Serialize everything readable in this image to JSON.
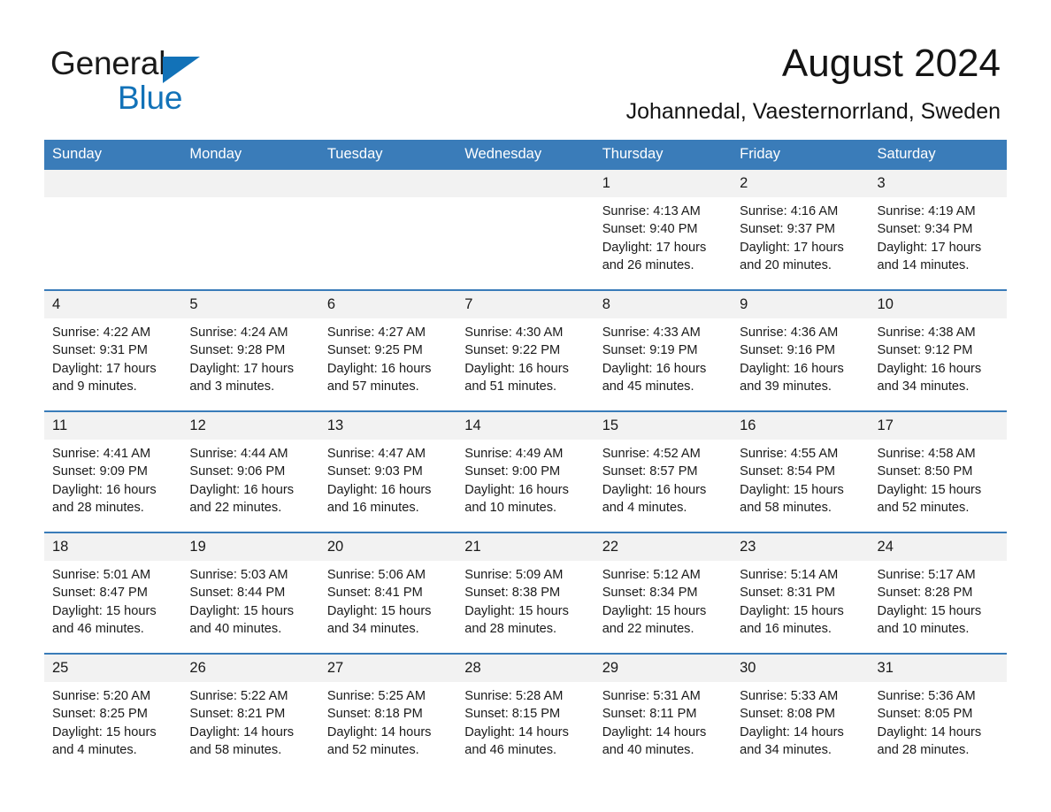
{
  "brand": {
    "name_part1": "General",
    "name_part2": "Blue",
    "triangle_color": "#1272b8",
    "accent_color": "#3a7cb9"
  },
  "header": {
    "month_title": "August 2024",
    "location": "Johannedal, Vaesternorrland, Sweden"
  },
  "calendar": {
    "weekday_headers": [
      "Sunday",
      "Monday",
      "Tuesday",
      "Wednesday",
      "Thursday",
      "Friday",
      "Saturday"
    ],
    "weeks": [
      [
        {
          "day": "",
          "sunrise": "",
          "sunset": "",
          "daylight_line1": "",
          "daylight_line2": ""
        },
        {
          "day": "",
          "sunrise": "",
          "sunset": "",
          "daylight_line1": "",
          "daylight_line2": ""
        },
        {
          "day": "",
          "sunrise": "",
          "sunset": "",
          "daylight_line1": "",
          "daylight_line2": ""
        },
        {
          "day": "",
          "sunrise": "",
          "sunset": "",
          "daylight_line1": "",
          "daylight_line2": ""
        },
        {
          "day": "1",
          "sunrise": "Sunrise: 4:13 AM",
          "sunset": "Sunset: 9:40 PM",
          "daylight_line1": "Daylight: 17 hours",
          "daylight_line2": "and 26 minutes."
        },
        {
          "day": "2",
          "sunrise": "Sunrise: 4:16 AM",
          "sunset": "Sunset: 9:37 PM",
          "daylight_line1": "Daylight: 17 hours",
          "daylight_line2": "and 20 minutes."
        },
        {
          "day": "3",
          "sunrise": "Sunrise: 4:19 AM",
          "sunset": "Sunset: 9:34 PM",
          "daylight_line1": "Daylight: 17 hours",
          "daylight_line2": "and 14 minutes."
        }
      ],
      [
        {
          "day": "4",
          "sunrise": "Sunrise: 4:22 AM",
          "sunset": "Sunset: 9:31 PM",
          "daylight_line1": "Daylight: 17 hours",
          "daylight_line2": "and 9 minutes."
        },
        {
          "day": "5",
          "sunrise": "Sunrise: 4:24 AM",
          "sunset": "Sunset: 9:28 PM",
          "daylight_line1": "Daylight: 17 hours",
          "daylight_line2": "and 3 minutes."
        },
        {
          "day": "6",
          "sunrise": "Sunrise: 4:27 AM",
          "sunset": "Sunset: 9:25 PM",
          "daylight_line1": "Daylight: 16 hours",
          "daylight_line2": "and 57 minutes."
        },
        {
          "day": "7",
          "sunrise": "Sunrise: 4:30 AM",
          "sunset": "Sunset: 9:22 PM",
          "daylight_line1": "Daylight: 16 hours",
          "daylight_line2": "and 51 minutes."
        },
        {
          "day": "8",
          "sunrise": "Sunrise: 4:33 AM",
          "sunset": "Sunset: 9:19 PM",
          "daylight_line1": "Daylight: 16 hours",
          "daylight_line2": "and 45 minutes."
        },
        {
          "day": "9",
          "sunrise": "Sunrise: 4:36 AM",
          "sunset": "Sunset: 9:16 PM",
          "daylight_line1": "Daylight: 16 hours",
          "daylight_line2": "and 39 minutes."
        },
        {
          "day": "10",
          "sunrise": "Sunrise: 4:38 AM",
          "sunset": "Sunset: 9:12 PM",
          "daylight_line1": "Daylight: 16 hours",
          "daylight_line2": "and 34 minutes."
        }
      ],
      [
        {
          "day": "11",
          "sunrise": "Sunrise: 4:41 AM",
          "sunset": "Sunset: 9:09 PM",
          "daylight_line1": "Daylight: 16 hours",
          "daylight_line2": "and 28 minutes."
        },
        {
          "day": "12",
          "sunrise": "Sunrise: 4:44 AM",
          "sunset": "Sunset: 9:06 PM",
          "daylight_line1": "Daylight: 16 hours",
          "daylight_line2": "and 22 minutes."
        },
        {
          "day": "13",
          "sunrise": "Sunrise: 4:47 AM",
          "sunset": "Sunset: 9:03 PM",
          "daylight_line1": "Daylight: 16 hours",
          "daylight_line2": "and 16 minutes."
        },
        {
          "day": "14",
          "sunrise": "Sunrise: 4:49 AM",
          "sunset": "Sunset: 9:00 PM",
          "daylight_line1": "Daylight: 16 hours",
          "daylight_line2": "and 10 minutes."
        },
        {
          "day": "15",
          "sunrise": "Sunrise: 4:52 AM",
          "sunset": "Sunset: 8:57 PM",
          "daylight_line1": "Daylight: 16 hours",
          "daylight_line2": "and 4 minutes."
        },
        {
          "day": "16",
          "sunrise": "Sunrise: 4:55 AM",
          "sunset": "Sunset: 8:54 PM",
          "daylight_line1": "Daylight: 15 hours",
          "daylight_line2": "and 58 minutes."
        },
        {
          "day": "17",
          "sunrise": "Sunrise: 4:58 AM",
          "sunset": "Sunset: 8:50 PM",
          "daylight_line1": "Daylight: 15 hours",
          "daylight_line2": "and 52 minutes."
        }
      ],
      [
        {
          "day": "18",
          "sunrise": "Sunrise: 5:01 AM",
          "sunset": "Sunset: 8:47 PM",
          "daylight_line1": "Daylight: 15 hours",
          "daylight_line2": "and 46 minutes."
        },
        {
          "day": "19",
          "sunrise": "Sunrise: 5:03 AM",
          "sunset": "Sunset: 8:44 PM",
          "daylight_line1": "Daylight: 15 hours",
          "daylight_line2": "and 40 minutes."
        },
        {
          "day": "20",
          "sunrise": "Sunrise: 5:06 AM",
          "sunset": "Sunset: 8:41 PM",
          "daylight_line1": "Daylight: 15 hours",
          "daylight_line2": "and 34 minutes."
        },
        {
          "day": "21",
          "sunrise": "Sunrise: 5:09 AM",
          "sunset": "Sunset: 8:38 PM",
          "daylight_line1": "Daylight: 15 hours",
          "daylight_line2": "and 28 minutes."
        },
        {
          "day": "22",
          "sunrise": "Sunrise: 5:12 AM",
          "sunset": "Sunset: 8:34 PM",
          "daylight_line1": "Daylight: 15 hours",
          "daylight_line2": "and 22 minutes."
        },
        {
          "day": "23",
          "sunrise": "Sunrise: 5:14 AM",
          "sunset": "Sunset: 8:31 PM",
          "daylight_line1": "Daylight: 15 hours",
          "daylight_line2": "and 16 minutes."
        },
        {
          "day": "24",
          "sunrise": "Sunrise: 5:17 AM",
          "sunset": "Sunset: 8:28 PM",
          "daylight_line1": "Daylight: 15 hours",
          "daylight_line2": "and 10 minutes."
        }
      ],
      [
        {
          "day": "25",
          "sunrise": "Sunrise: 5:20 AM",
          "sunset": "Sunset: 8:25 PM",
          "daylight_line1": "Daylight: 15 hours",
          "daylight_line2": "and 4 minutes."
        },
        {
          "day": "26",
          "sunrise": "Sunrise: 5:22 AM",
          "sunset": "Sunset: 8:21 PM",
          "daylight_line1": "Daylight: 14 hours",
          "daylight_line2": "and 58 minutes."
        },
        {
          "day": "27",
          "sunrise": "Sunrise: 5:25 AM",
          "sunset": "Sunset: 8:18 PM",
          "daylight_line1": "Daylight: 14 hours",
          "daylight_line2": "and 52 minutes."
        },
        {
          "day": "28",
          "sunrise": "Sunrise: 5:28 AM",
          "sunset": "Sunset: 8:15 PM",
          "daylight_line1": "Daylight: 14 hours",
          "daylight_line2": "and 46 minutes."
        },
        {
          "day": "29",
          "sunrise": "Sunrise: 5:31 AM",
          "sunset": "Sunset: 8:11 PM",
          "daylight_line1": "Daylight: 14 hours",
          "daylight_line2": "and 40 minutes."
        },
        {
          "day": "30",
          "sunrise": "Sunrise: 5:33 AM",
          "sunset": "Sunset: 8:08 PM",
          "daylight_line1": "Daylight: 14 hours",
          "daylight_line2": "and 34 minutes."
        },
        {
          "day": "31",
          "sunrise": "Sunrise: 5:36 AM",
          "sunset": "Sunset: 8:05 PM",
          "daylight_line1": "Daylight: 14 hours",
          "daylight_line2": "and 28 minutes."
        }
      ]
    ]
  }
}
